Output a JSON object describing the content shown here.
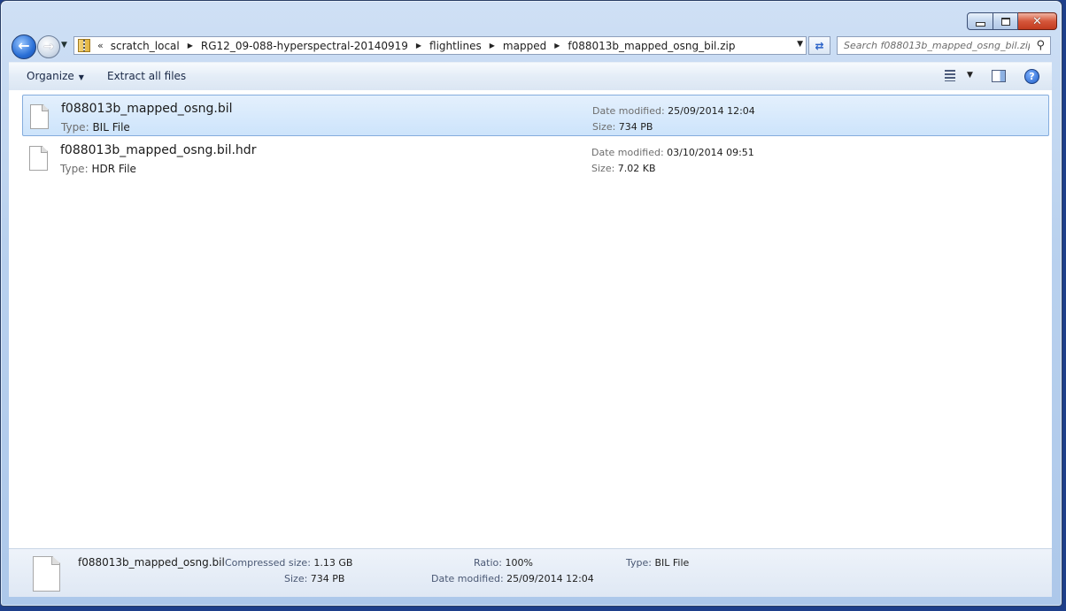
{
  "window": {
    "caption": {
      "close_label": "✕"
    }
  },
  "nav": {
    "breadcrumb": [
      "scratch_local",
      "RG12_09-088-hyperspectral-20140919",
      "flightlines",
      "mapped",
      "f088013b_mapped_osng_bil.zip"
    ],
    "overflow": "«",
    "search_placeholder": "Search f088013b_mapped_osng_bil.zip"
  },
  "toolbar": {
    "organize_label": "Organize",
    "extract_label": "Extract all files"
  },
  "files": [
    {
      "name": "f088013b_mapped_osng.bil",
      "type_label": "Type:",
      "type": "BIL File",
      "date_label": "Date modified:",
      "date": "25/09/2014 12:04",
      "size_label": "Size:",
      "size": "734 PB",
      "selected": true
    },
    {
      "name": "f088013b_mapped_osng.bil.hdr",
      "type_label": "Type:",
      "type": "HDR File",
      "date_label": "Date modified:",
      "date": "03/10/2014 09:51",
      "size_label": "Size:",
      "size": "7.02 KB",
      "selected": false
    }
  ],
  "details": {
    "name": "f088013b_mapped_osng.bil",
    "compressed_label": "Compressed size:",
    "compressed": "1.13 GB",
    "size_label": "Size:",
    "size": "734 PB",
    "ratio_label": "Ratio:",
    "ratio": "100%",
    "date_label": "Date modified:",
    "date": "25/09/2014 12:04",
    "type_label": "Type:",
    "type": "BIL File"
  },
  "colors": {
    "selection": "#cde4fb",
    "selection_border": "#84acdd",
    "desktop": "#1e3f8a"
  }
}
